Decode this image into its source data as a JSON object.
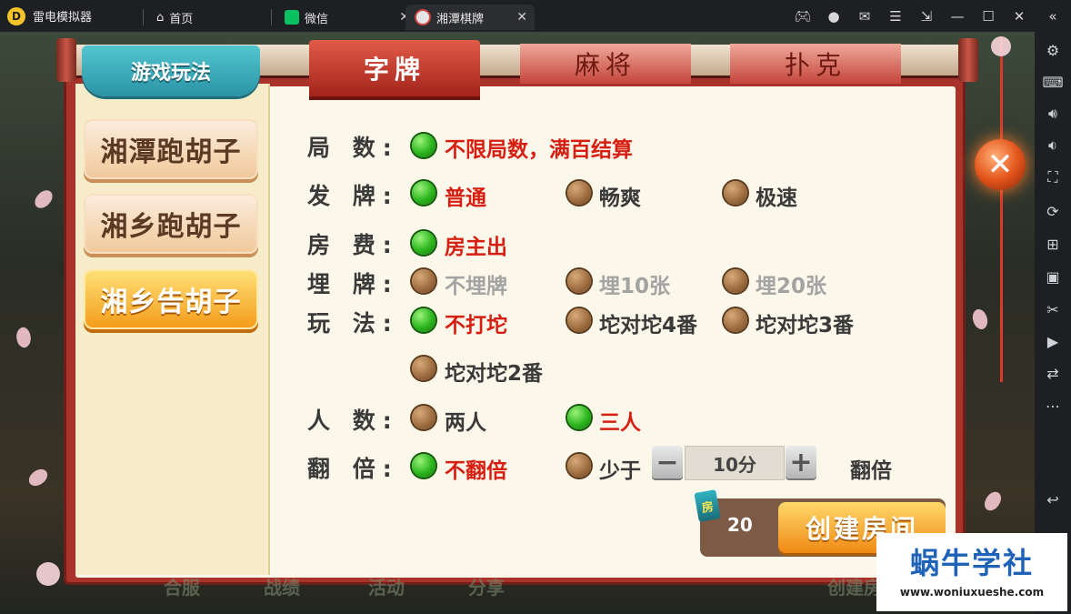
{
  "app": {
    "name": "雷电模拟器"
  },
  "tabs": [
    {
      "label": "首页",
      "icon": "home-icon"
    },
    {
      "label": "微信",
      "icon": "wechat-icon"
    },
    {
      "label": "湘潭棋牌",
      "icon": "game-icon"
    }
  ],
  "game": {
    "section_title": "游戏玩法",
    "categories": [
      "湘潭跑胡子",
      "湘乡跑胡子",
      "湘乡告胡子"
    ],
    "active_category": "湘乡告胡子",
    "top_tabs": [
      "字牌",
      "麻将",
      "扑克"
    ],
    "rows": {
      "rounds": {
        "label": "局 数:",
        "options": [
          "不限局数，满百结算"
        ]
      },
      "deal": {
        "label": "发 牌:",
        "options": [
          "普通",
          "畅爽",
          "极速"
        ]
      },
      "fee": {
        "label": "房 费:",
        "options": [
          "房主出"
        ]
      },
      "bury": {
        "label": "埋 牌:",
        "options": [
          "不埋牌",
          "埋10张",
          "埋20张"
        ]
      },
      "play": {
        "label": "玩 法:",
        "options": [
          "不打坨",
          "坨对坨4番",
          "坨对坨3番",
          "坨对坨2番"
        ]
      },
      "players": {
        "label": "人 数:",
        "options": [
          "两人",
          "三人"
        ]
      },
      "double": {
        "label": "翻 倍:",
        "options": [
          "不翻倍",
          "少于",
          "翻倍"
        ],
        "stepper_value": "10分"
      }
    },
    "room_badge": "房",
    "cost": "20",
    "create_label": "创建房间",
    "close_symbol": "✕",
    "footer_labels": [
      "合服",
      "战绩",
      "活动",
      "分享",
      "创建房"
    ]
  },
  "watermark": {
    "title": "蜗牛学社",
    "url": "www.woniuxueshe.com"
  },
  "colors": {
    "selected": "#2bb51d",
    "unselected": "#9a6a3e",
    "accent_red": "#d61f12",
    "panel_red": "#a9332b"
  }
}
